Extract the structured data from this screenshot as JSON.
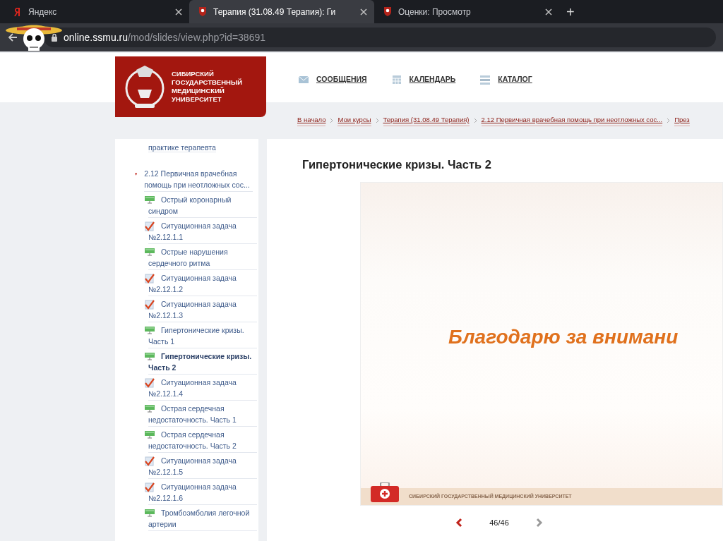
{
  "browser": {
    "tabs": [
      {
        "label": "Яндекс",
        "kind": "yandex",
        "selected": false
      },
      {
        "label": "Терапия (31.08.49 Терапия): Ги",
        "kind": "site",
        "selected": true
      },
      {
        "label": "Оценки: Просмотр",
        "kind": "site",
        "selected": false
      }
    ],
    "new_tab": "+",
    "url_host": "online.ssmu.ru",
    "url_path": "/mod/slides/view.php?id=38691"
  },
  "header": {
    "logo_lines": [
      "СИБИРСКИЙ",
      "ГОСУДАРСТВЕННЫЙ",
      "МЕДИЦИНСКИЙ",
      "УНИВЕРСИТЕТ"
    ],
    "nav": [
      {
        "label": "СООБЩЕНИЯ",
        "kind": "mail"
      },
      {
        "label": "КАЛЕНДАРЬ",
        "kind": "calendar"
      },
      {
        "label": "КАТАЛОГ",
        "kind": "catalog"
      }
    ]
  },
  "breadcrumb": [
    "В начало",
    "Мои курсы",
    "Терапия (31.08.49 Терапия)",
    "2.12 Первичная врачебная помощь при неотложных сос...",
    "През"
  ],
  "sidebar": {
    "partial_item": "практике терапевта",
    "section": {
      "label": "2.12 Первичная врачебная помощь при неотложных сос...",
      "expanded": true,
      "children": [
        {
          "label": "Острый коронарный синдром",
          "kind": "slides",
          "selected": false
        },
        {
          "label": "Ситуационная задача №2.12.1.1",
          "kind": "quiz",
          "selected": false
        },
        {
          "label": "Острые нарушения сердечного ритма",
          "kind": "slides",
          "selected": false
        },
        {
          "label": "Ситуационная задача №2.12.1.2",
          "kind": "quiz",
          "selected": false
        },
        {
          "label": "Ситуационная задача №2.12.1.3",
          "kind": "quiz",
          "selected": false
        },
        {
          "label": "Гипертонические кризы. Часть 1",
          "kind": "slides",
          "selected": false
        },
        {
          "label": "Гипертонические кризы. Часть 2",
          "kind": "slides",
          "selected": true
        },
        {
          "label": "Ситуационная задача №2.12.1.4",
          "kind": "quiz",
          "selected": false
        },
        {
          "label": "Острая сердечная недостаточность. Часть 1",
          "kind": "slides",
          "selected": false
        },
        {
          "label": "Острая сердечная недостаточность. Часть 2",
          "kind": "slides",
          "selected": false
        },
        {
          "label": "Ситуационная задача №2.12.1.5",
          "kind": "quiz",
          "selected": false
        },
        {
          "label": "Ситуационная задача №2.12.1.6",
          "kind": "quiz",
          "selected": false
        },
        {
          "label": "Тромбоэмболия легочной артерии",
          "kind": "slides",
          "selected": false
        }
      ]
    }
  },
  "main": {
    "title": "Гипертонические кризы. Часть 2",
    "slide": {
      "text": "Благодарю за внимани",
      "footer": "СИБИРСКИЙ ГОСУДАРСТВЕННЫЙ МЕДИЦИНСКИЙ УНИВЕРСИТЕТ"
    },
    "pager": {
      "counter": "46/46",
      "prev_disabled": false,
      "next_disabled": true
    }
  }
}
